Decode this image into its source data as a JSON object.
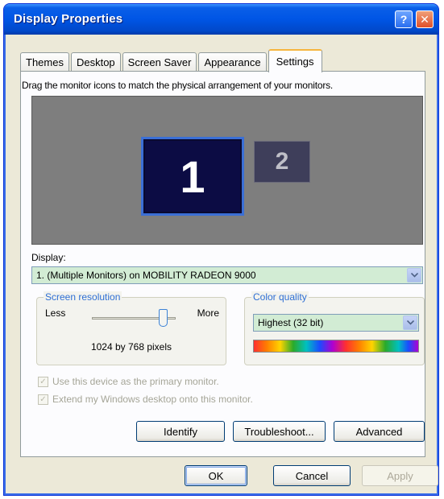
{
  "window": {
    "title": "Display Properties",
    "help_glyph": "?",
    "close_glyph": "✕"
  },
  "tabs": [
    {
      "label": "Themes"
    },
    {
      "label": "Desktop"
    },
    {
      "label": "Screen Saver"
    },
    {
      "label": "Appearance"
    },
    {
      "label": "Settings",
      "active": true
    }
  ],
  "settings": {
    "instruction": "Drag the monitor icons to match the physical arrangement of your monitors.",
    "monitor_1_label": "1",
    "monitor_2_label": "2",
    "display_label": "Display:",
    "display_value": "1. (Multiple Monitors) on MOBILITY RADEON 9000",
    "resolution": {
      "title": "Screen resolution",
      "less_label": "Less",
      "more_label": "More",
      "value_text": "1024 by 768 pixels",
      "slider_fraction": 0.85
    },
    "color": {
      "title": "Color quality",
      "value": "Highest (32 bit)"
    },
    "primary_checkbox_label": "Use this device as the primary monitor.",
    "extend_checkbox_label": "Extend my Windows desktop onto this monitor.",
    "identify_label": "Identify",
    "troubleshoot_label": "Troubleshoot...",
    "advanced_label": "Advanced"
  },
  "footer": {
    "ok_label": "OK",
    "cancel_label": "Cancel",
    "apply_label": "Apply"
  },
  "colors": {
    "titlebar": "#0055e5",
    "dialog_bg": "#ece9d8",
    "select_bg": "#d2ecd4",
    "monitor_area": "#7e7e7e",
    "group_title": "#2f6fd4"
  },
  "icons": {
    "dropdown": "chevron-down-icon",
    "check": "check-icon"
  }
}
